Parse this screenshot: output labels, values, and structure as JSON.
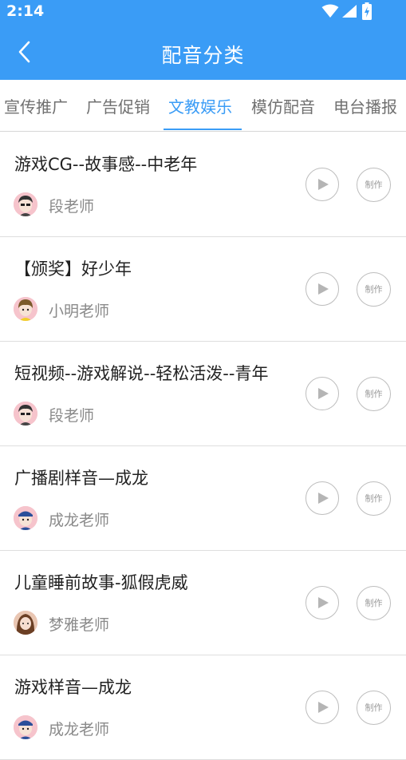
{
  "status_bar": {
    "time": "2:14",
    "icons": [
      "wifi-icon",
      "signal-icon",
      "battery-charging-icon"
    ]
  },
  "header": {
    "title": "配音分类",
    "back_icon": "chevron-left-icon",
    "background_color": "#3a9cf6"
  },
  "tabs": [
    {
      "label": "宣传推广",
      "active": false
    },
    {
      "label": "广告促销",
      "active": false
    },
    {
      "label": "文教娱乐",
      "active": true
    },
    {
      "label": "模仿配音",
      "active": false
    },
    {
      "label": "电台播报",
      "active": false
    }
  ],
  "accent_color": "#3a9cf6",
  "items": [
    {
      "title": "游戏CG--故事感--中老年",
      "teacher": "段老师",
      "avatar_icon": "male-avatar-icon",
      "play_icon": "play-icon",
      "make_label": "制作"
    },
    {
      "title": "【颁奖】好少年",
      "teacher": "小明老师",
      "avatar_icon": "boy-avatar-icon",
      "play_icon": "play-icon",
      "make_label": "制作"
    },
    {
      "title": "短视频--游戏解说--轻松活泼--青年",
      "teacher": "段老师",
      "avatar_icon": "male-avatar-icon",
      "play_icon": "play-icon",
      "make_label": "制作"
    },
    {
      "title": "广播剧样音—成龙",
      "teacher": "成龙老师",
      "avatar_icon": "cartoon-avatar-icon",
      "play_icon": "play-icon",
      "make_label": "制作"
    },
    {
      "title": "儿童睡前故事-狐假虎威",
      "teacher": "梦雅老师",
      "avatar_icon": "female-avatar-icon",
      "play_icon": "play-icon",
      "make_label": "制作"
    },
    {
      "title": "游戏样音—成龙",
      "teacher": "成龙老师",
      "avatar_icon": "cartoon-avatar-icon",
      "play_icon": "play-icon",
      "make_label": "制作"
    }
  ]
}
